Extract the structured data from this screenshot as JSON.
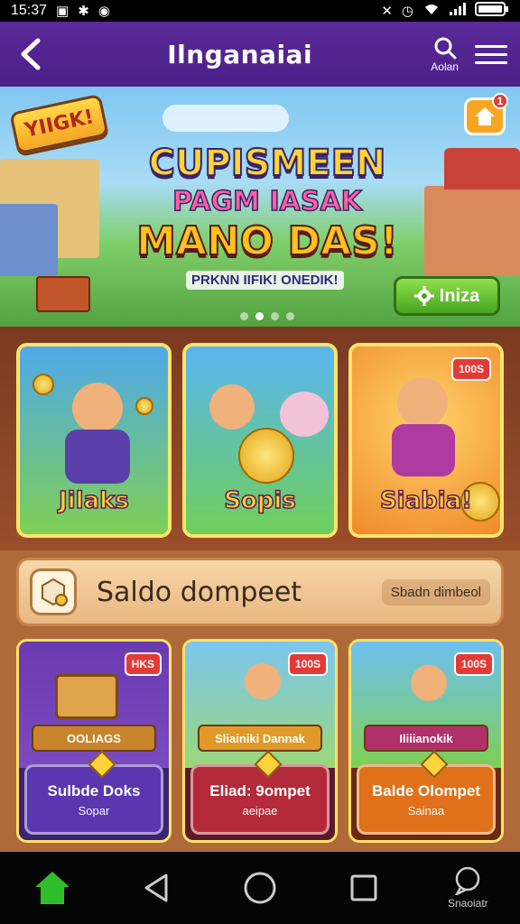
{
  "status_bar": {
    "time": "15:37"
  },
  "app_bar": {
    "title": "Ilnganaiai",
    "search_label": "Aolan"
  },
  "hero": {
    "badge": "YIIGK!",
    "bell_count": "1",
    "line1": "CUPISMEEN",
    "line2": "PAGM IASAK",
    "line3": "MANO DAS!",
    "subtitle": "PRKNN IIFIK! ONEDIK!",
    "cta_label": "Iniza",
    "slide_count": 4,
    "active_slide": 1
  },
  "game_cards": [
    {
      "label": "Jilaks",
      "chip": ""
    },
    {
      "label": "Sopis",
      "chip": ""
    },
    {
      "label": "Siabia!",
      "chip": "100S"
    }
  ],
  "wallet": {
    "title": "Saldo dompeet",
    "value": "Sbadn dimbeol"
  },
  "wallet_cards": [
    {
      "ribbon": "OOLIAGS",
      "chip": "HKS",
      "title": "Sulbde Doks",
      "sub": "Sopar"
    },
    {
      "ribbon": "Sliainiki Dannak",
      "chip": "100S",
      "title": "Eliad: 9ompet",
      "sub": "aeipae"
    },
    {
      "ribbon": "Iliiianokik",
      "chip": "100S",
      "title": "Balde Olompet",
      "sub": "Sainaa"
    }
  ],
  "nav": {
    "assistant_label": "Snaoiatr"
  },
  "colors": {
    "brand": "#4a1f86",
    "accent": "#ffcf3a",
    "cta": "#48a520",
    "home": "#2fbf2a"
  }
}
